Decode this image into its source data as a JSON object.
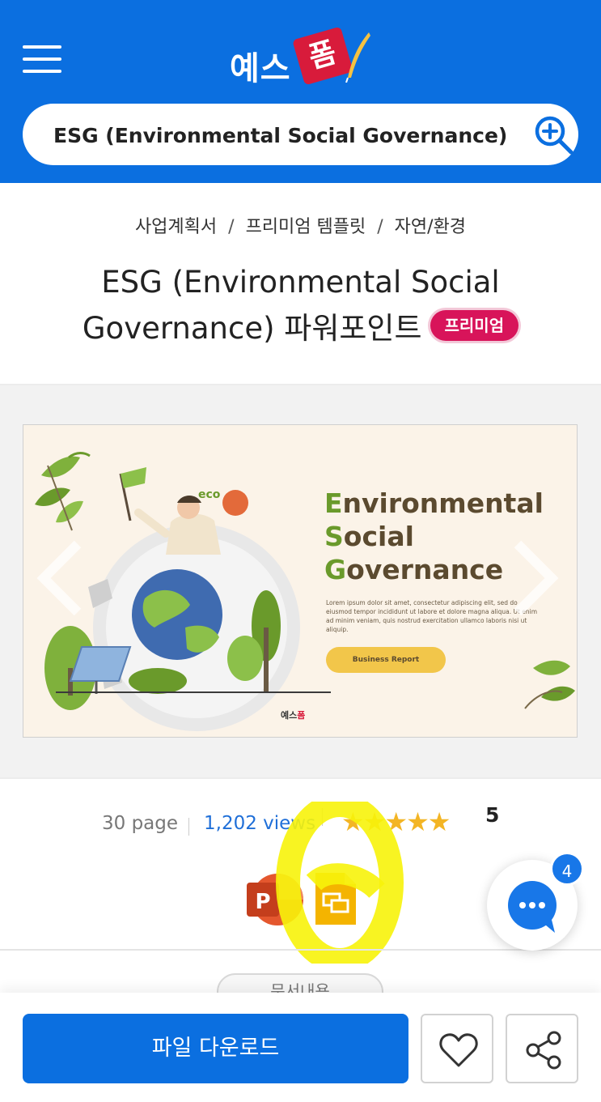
{
  "header": {
    "logo_text": "예스",
    "logo_badge": "폼",
    "search": {
      "value": "ESG (Environmental Social Governance) 파워포인트",
      "placeholder": ""
    }
  },
  "breadcrumb": [
    "사업계획서",
    "프리미엄 템플릿",
    "자연/환경"
  ],
  "product": {
    "title": "ESG (Environmental Social Governance) 파워포인트",
    "premium_badge": "프리미엄"
  },
  "preview": {
    "title_lines": [
      {
        "cap": "E",
        "rest": "nvironmental"
      },
      {
        "cap": "S",
        "rest": "ocial"
      },
      {
        "cap": "G",
        "rest": "overnance"
      }
    ],
    "eco_label": "eco",
    "body_text": "Lorem ipsum dolor sit amet, consectetur adipiscing elit, sed do eiusmod tempor incididunt ut labore et dolore magna aliqua. Ut enim ad minim veniam, quis nostrud exercitation ullamco laboris nisi ut aliquip.",
    "button_label": "Business Report",
    "footer_logo_a": "예스",
    "footer_logo_b": "폼"
  },
  "stats": {
    "pages": "30 page",
    "views": "1,202 views",
    "star_glyphs": "★★★★★",
    "rating": "5"
  },
  "formats": [
    "powerpoint-icon",
    "google-slides-icon"
  ],
  "tab_peek": "문서내용",
  "chat": {
    "unread": "4"
  },
  "actions": {
    "download_label": "파일 다운로드"
  },
  "colors": {
    "brand_blue": "#0b6fe0",
    "premium_pink": "#d8145a",
    "star_gold": "#f3b525",
    "highlight_yellow": "#f7f30a"
  }
}
